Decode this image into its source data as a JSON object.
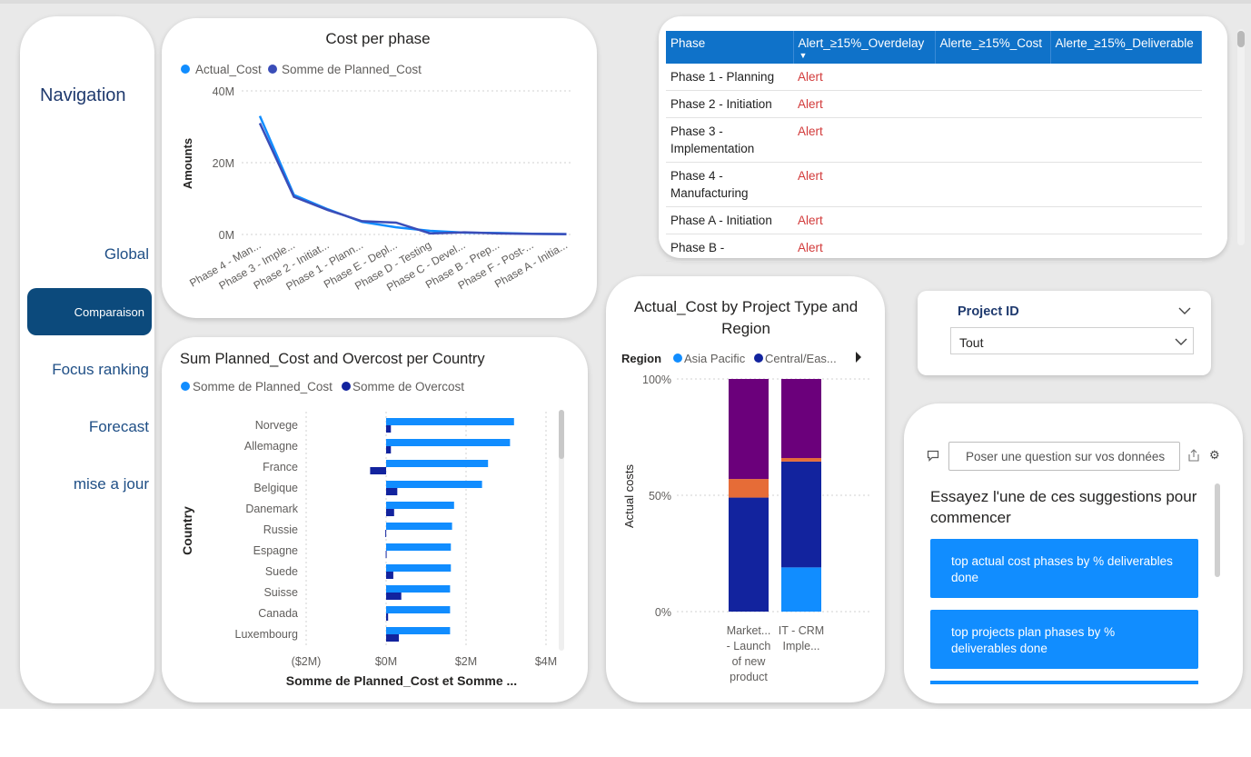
{
  "navigation": {
    "title": "Navigation",
    "items": [
      {
        "label": "Global"
      },
      {
        "label": "Comparaison",
        "active": true
      },
      {
        "label": "Focus ranking"
      },
      {
        "label": "Forecast"
      },
      {
        "label": "mise a jour"
      }
    ]
  },
  "cost_per_phase": {
    "title": "Cost per phase",
    "legend": [
      "Actual_Cost",
      "Somme de Planned_Cost"
    ],
    "ylabel": "Amounts",
    "yticks": [
      "0M",
      "20M",
      "40M"
    ],
    "categories": [
      "Phase 4 - Man...",
      "Phase 3 - Imple...",
      "Phase 2 - Initiat...",
      "Phase 1 - Plann...",
      "Phase E - Depl...",
      "Phase D - Testing",
      "Phase C - Devel...",
      "Phase B - Prep...",
      "Phase F - Post-...",
      "Phase A - Initia..."
    ]
  },
  "overcost_chart": {
    "title": "Sum Planned_Cost and Overcost per Country",
    "legend": [
      "Somme de Planned_Cost",
      "Somme de Overcost"
    ],
    "ylabel": "Country",
    "xlabel": "Somme de Planned_Cost et Somme ...",
    "xticks": [
      "($2M)",
      "$0M",
      "$2M",
      "$4M"
    ]
  },
  "project_type_chart": {
    "title": "Actual_Cost by Project Type and Region",
    "legend_title": "Region",
    "legend": [
      "Asia Pacific",
      "Central/Eas..."
    ],
    "ylabel": "Actual costs",
    "yticks": [
      "0%",
      "50%",
      "100%"
    ],
    "categories": [
      [
        "Market...",
        "- Launch",
        "of new",
        "product"
      ],
      [
        "IT - CRM",
        "Imple..."
      ]
    ]
  },
  "alerts_table": {
    "headers": [
      "Phase",
      "Alert_≥15%_Overdelay",
      "Alerte_≥15%_Cost",
      "Alerte_≥15%_Deliverable"
    ],
    "rows": [
      [
        "Phase 1 - Planning",
        "Alert",
        "",
        ""
      ],
      [
        "Phase 2 - Initiation",
        "Alert",
        "",
        ""
      ],
      [
        "Phase 3 - Implementation",
        "Alert",
        "",
        ""
      ],
      [
        "Phase 4 - Manufacturing",
        "Alert",
        "",
        ""
      ],
      [
        "Phase A - Initiation",
        "Alert",
        "",
        ""
      ],
      [
        "Phase B -",
        "Alert",
        "",
        ""
      ]
    ]
  },
  "slicer": {
    "title": "Project ID",
    "value": "Tout"
  },
  "qna": {
    "placeholder": "Poser une question sur vos données",
    "heading": "Essayez l'une de ces suggestions pour commencer",
    "suggestions": [
      "top actual cost phases by % deliverables done",
      "top projects plan phases by % deliverables done"
    ]
  },
  "colors": {
    "nav_active": "#0c4a7c",
    "header_blue": "#0f72c9",
    "alert_red": "#d23a3a",
    "light_blue": "#118dff",
    "dark_blue": "#12239e",
    "purple": "#6b007b",
    "orange": "#e66c37"
  },
  "chart_data": [
    {
      "type": "line",
      "title": "Cost per phase",
      "xlabel": "",
      "ylabel": "Amounts",
      "ylim": [
        0,
        40000000
      ],
      "categories": [
        "Phase 4 - Man...",
        "Phase 3 - Imple...",
        "Phase 2 - Initiat...",
        "Phase 1 - Plann...",
        "Phase E - Depl...",
        "Phase D - Testing",
        "Phase C - Devel...",
        "Phase B - Prep...",
        "Phase F - Post-...",
        "Phase A - Initia..."
      ],
      "series": [
        {
          "name": "Actual_Cost",
          "values": [
            33000000,
            11000000,
            7000000,
            3500000,
            2000000,
            1000000,
            500000,
            400000,
            200000,
            100000
          ]
        },
        {
          "name": "Somme de Planned_Cost",
          "values": [
            31000000,
            10500000,
            6800000,
            3700000,
            3300000,
            300000,
            600000,
            300000,
            150000,
            100000
          ]
        }
      ]
    },
    {
      "type": "bar",
      "orientation": "horizontal",
      "title": "Sum Planned_Cost and Overcost per Country",
      "xlabel": "Somme de Planned_Cost et Somme ...",
      "ylabel": "Country",
      "xlim": [
        -2000000,
        4000000
      ],
      "categories": [
        "Norvege",
        "Allemagne",
        "France",
        "Belgique",
        "Danemark",
        "Russie",
        "Espagne",
        "Suede",
        "Suisse",
        "Canada",
        "Luxembourg"
      ],
      "series": [
        {
          "name": "Somme de Planned_Cost",
          "values": [
            3200000,
            3100000,
            2550000,
            2400000,
            1700000,
            1650000,
            1620000,
            1620000,
            1600000,
            1600000,
            1600000
          ]
        },
        {
          "name": "Somme de Overcost",
          "values": [
            120000,
            120000,
            -400000,
            280000,
            200000,
            -20000,
            -10000,
            180000,
            380000,
            50000,
            320000
          ]
        }
      ]
    },
    {
      "type": "bar",
      "stacked": "percent",
      "title": "Actual_Cost by Project Type and Region",
      "ylabel": "Actual costs",
      "ylim": [
        0,
        100
      ],
      "categories": [
        "Market... - Launch of new product",
        "IT - CRM Imple..."
      ],
      "series": [
        {
          "name": "Asia Pacific",
          "values": [
            0,
            19
          ]
        },
        {
          "name": "Central/Eas...",
          "values": [
            49,
            45.5
          ]
        },
        {
          "name": "",
          "values": [
            8,
            1.5
          ]
        },
        {
          "name": "",
          "values": [
            43,
            34
          ]
        }
      ]
    }
  ]
}
